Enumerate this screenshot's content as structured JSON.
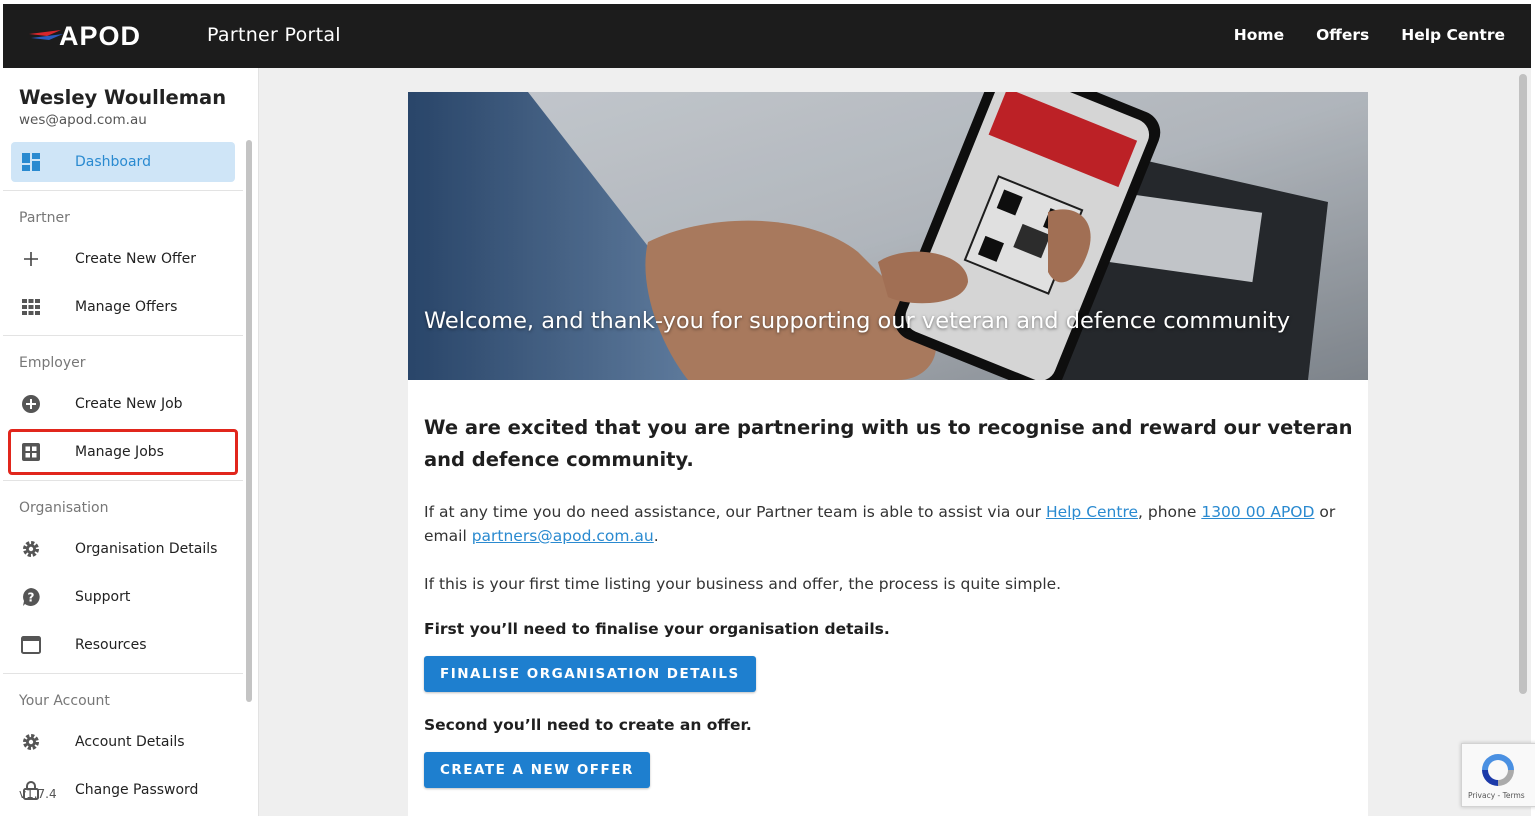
{
  "header": {
    "logo_text": "APOD",
    "title": "Partner Portal",
    "nav": [
      "Home",
      "Offers",
      "Help Centre"
    ]
  },
  "sidebar": {
    "user_name": "Wesley Woulleman",
    "user_email": "wes@apod.com.au",
    "dashboard": "Dashboard",
    "sections": {
      "partner": "Partner",
      "employer": "Employer",
      "organisation": "Organisation",
      "account": "Your Account"
    },
    "items": {
      "create_offer": "Create New Offer",
      "manage_offers": "Manage Offers",
      "create_job": "Create New Job",
      "manage_jobs": "Manage Jobs",
      "org_details": "Organisation Details",
      "support": "Support",
      "resources": "Resources",
      "account_details": "Account Details",
      "change_password": "Change Password"
    },
    "version": "v1.7.4"
  },
  "main": {
    "hero_caption": "Welcome, and thank-you for supporting our veteran and defence community",
    "headline": "We are excited that you are partnering with us to recognise and reward our veteran and defence community.",
    "assist_prefix": "If at any time you do need assistance, our Partner team is able to assist via our ",
    "assist_link_help": "Help Centre",
    "assist_mid": ", phone ",
    "assist_link_phone": "1300 00 APOD",
    "assist_mid2": " or email ",
    "assist_link_email": "partners@apod.com.au",
    "assist_end": ".",
    "first_time": "If this is your first time listing your business and offer, the process is quite simple.",
    "step1": "First you’ll need to finalise your organisation details.",
    "step1_button": "FINALISE ORGANISATION DETAILS",
    "step2": "Second you’ll need to create an offer.",
    "step2_button": "CREATE A NEW OFFER"
  },
  "recaptcha": {
    "text": "Privacy - Terms"
  },
  "colors": {
    "topbar": "#1c1c1c",
    "accent": "#1e7fcf",
    "active_bg": "#cfe5f7",
    "highlight": "#e1261c"
  }
}
